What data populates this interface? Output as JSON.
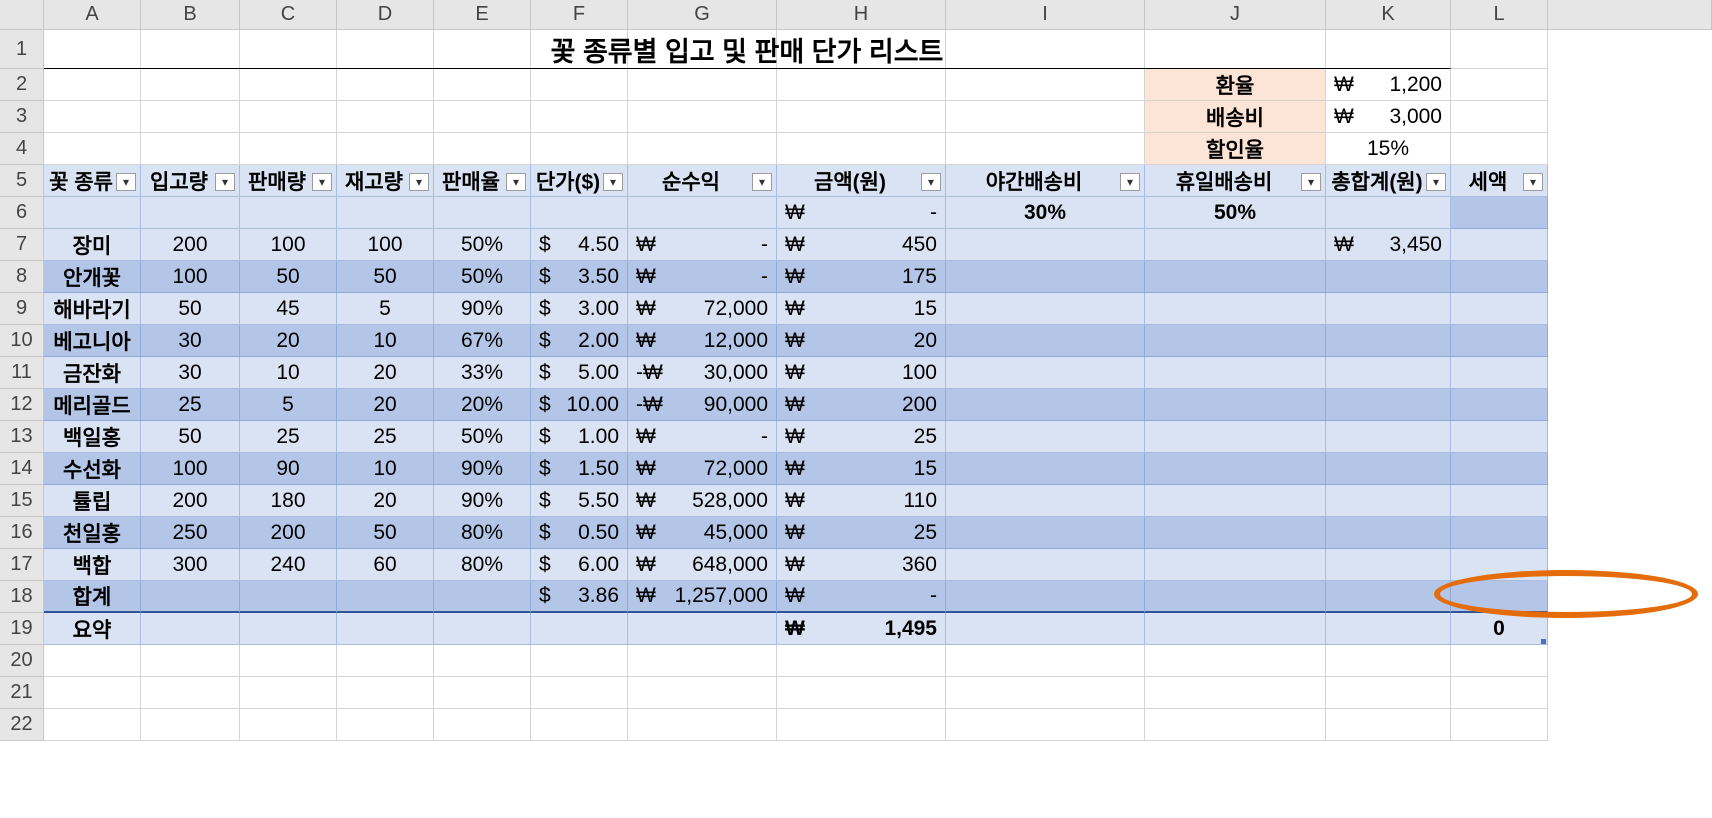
{
  "columns": [
    "A",
    "B",
    "C",
    "D",
    "E",
    "F",
    "G",
    "H",
    "I",
    "J",
    "K",
    "L"
  ],
  "rows": [
    "1",
    "2",
    "3",
    "4",
    "5",
    "6",
    "7",
    "8",
    "9",
    "10",
    "11",
    "12",
    "13",
    "14",
    "15",
    "16",
    "17",
    "18",
    "19",
    "20",
    "21",
    "22"
  ],
  "title": "꽃 종류별 입고 및 판매 단가 리스트",
  "params": {
    "exchange_label": "환율",
    "exchange_sym": "₩",
    "exchange_val": "1,200",
    "shipping_label": "배송비",
    "shipping_sym": "₩",
    "shipping_val": "3,000",
    "discount_label": "할인율",
    "discount_val": "15%"
  },
  "headers": [
    "꽃 종류",
    "입고량",
    "판매량",
    "재고량",
    "판매율",
    "단가($)",
    "순수익",
    "금액(원)",
    "야간배송비",
    "휴일배송비",
    "총합계(원)",
    "세액"
  ],
  "row6": {
    "h_sym": "₩",
    "h_val": "-",
    "night": "30%",
    "holiday": "50%"
  },
  "data": [
    {
      "name": "장미",
      "in": "200",
      "sold": "100",
      "stock": "100",
      "rate": "50%",
      "price": "4.50",
      "profit_sign": "",
      "profit": "-",
      "amount": "450",
      "total": "3,450"
    },
    {
      "name": "안개꽃",
      "in": "100",
      "sold": "50",
      "stock": "50",
      "rate": "50%",
      "price": "3.50",
      "profit_sign": "",
      "profit": "-",
      "amount": "175",
      "total": ""
    },
    {
      "name": "해바라기",
      "in": "50",
      "sold": "45",
      "stock": "5",
      "rate": "90%",
      "price": "3.00",
      "profit_sign": "",
      "profit": "72,000",
      "amount": "15",
      "total": ""
    },
    {
      "name": "베고니아",
      "in": "30",
      "sold": "20",
      "stock": "10",
      "rate": "67%",
      "price": "2.00",
      "profit_sign": "",
      "profit": "12,000",
      "amount": "20",
      "total": ""
    },
    {
      "name": "금잔화",
      "in": "30",
      "sold": "10",
      "stock": "20",
      "rate": "33%",
      "price": "5.00",
      "profit_sign": "-",
      "profit": "30,000",
      "amount": "100",
      "total": ""
    },
    {
      "name": "메리골드",
      "in": "25",
      "sold": "5",
      "stock": "20",
      "rate": "20%",
      "price": "10.00",
      "profit_sign": "-",
      "profit": "90,000",
      "amount": "200",
      "total": ""
    },
    {
      "name": "백일홍",
      "in": "50",
      "sold": "25",
      "stock": "25",
      "rate": "50%",
      "price": "1.00",
      "profit_sign": "",
      "profit": "-",
      "amount": "25",
      "total": ""
    },
    {
      "name": "수선화",
      "in": "100",
      "sold": "90",
      "stock": "10",
      "rate": "90%",
      "price": "1.50",
      "profit_sign": "",
      "profit": "72,000",
      "amount": "15",
      "total": ""
    },
    {
      "name": "튤립",
      "in": "200",
      "sold": "180",
      "stock": "20",
      "rate": "90%",
      "price": "5.50",
      "profit_sign": "",
      "profit": "528,000",
      "amount": "110",
      "total": ""
    },
    {
      "name": "천일홍",
      "in": "250",
      "sold": "200",
      "stock": "50",
      "rate": "80%",
      "price": "0.50",
      "profit_sign": "",
      "profit": "45,000",
      "amount": "25",
      "total": ""
    },
    {
      "name": "백합",
      "in": "300",
      "sold": "240",
      "stock": "60",
      "rate": "80%",
      "price": "6.00",
      "profit_sign": "",
      "profit": "648,000",
      "amount": "360",
      "total": ""
    }
  ],
  "won": "₩",
  "dollar": "$",
  "total_row": {
    "label": "합계",
    "price": "3.86",
    "profit": "1,257,000",
    "amount": "-"
  },
  "summary_row": {
    "label": "요약",
    "amount": "1,495",
    "tax": "0"
  },
  "colors": {
    "band_light": "#dae3f3",
    "band_dark": "#b4c6e7",
    "param_fill": "#fce4d6",
    "annotation": "#e46c0a"
  }
}
